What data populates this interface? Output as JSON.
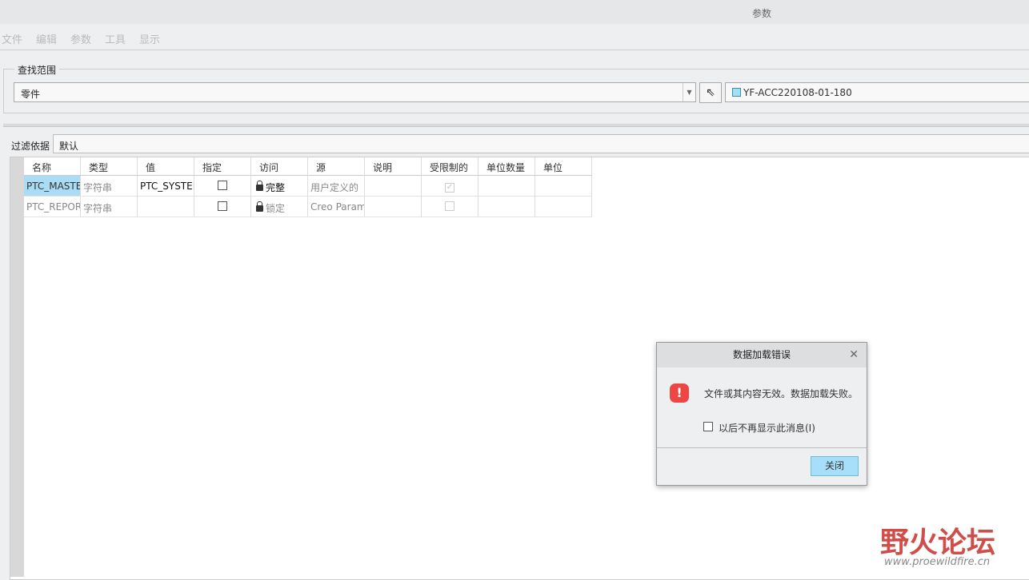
{
  "window": {
    "title": "参数"
  },
  "menu": [
    "文件",
    "编辑",
    "参数",
    "工具",
    "显示"
  ],
  "scope": {
    "label": "查找范围",
    "value": "零件",
    "model": "YF-ACC220108-01-180"
  },
  "filter": {
    "label": "过滤依据",
    "value": "默认"
  },
  "table": {
    "headers": [
      "名称",
      "类型",
      "值",
      "指定",
      "访问",
      "源",
      "说明",
      "受限制的",
      "单位数量",
      "单位"
    ],
    "rows": [
      {
        "name": "PTC_MASTER",
        "type": "字符串",
        "value": "PTC_SYSTEM",
        "designate": false,
        "access": "完整",
        "source": "用户定义的",
        "desc": "",
        "restricted": true,
        "unit_qty": "",
        "unit": ""
      },
      {
        "name": "PTC_REPORT",
        "type": "字符串",
        "value": "",
        "designate": false,
        "access": "锁定",
        "source": "Creo Parametric",
        "desc": "",
        "restricted": false,
        "unit_qty": "",
        "unit": ""
      }
    ]
  },
  "dialog": {
    "title": "数据加载错误",
    "message": "文件或其内容无效。数据加载失败。",
    "checkbox_label": "以后不再显示此消息(I)",
    "close_label": "关闭"
  },
  "watermark": {
    "text": "野火论坛",
    "url": "www.proewildfire.cn"
  }
}
